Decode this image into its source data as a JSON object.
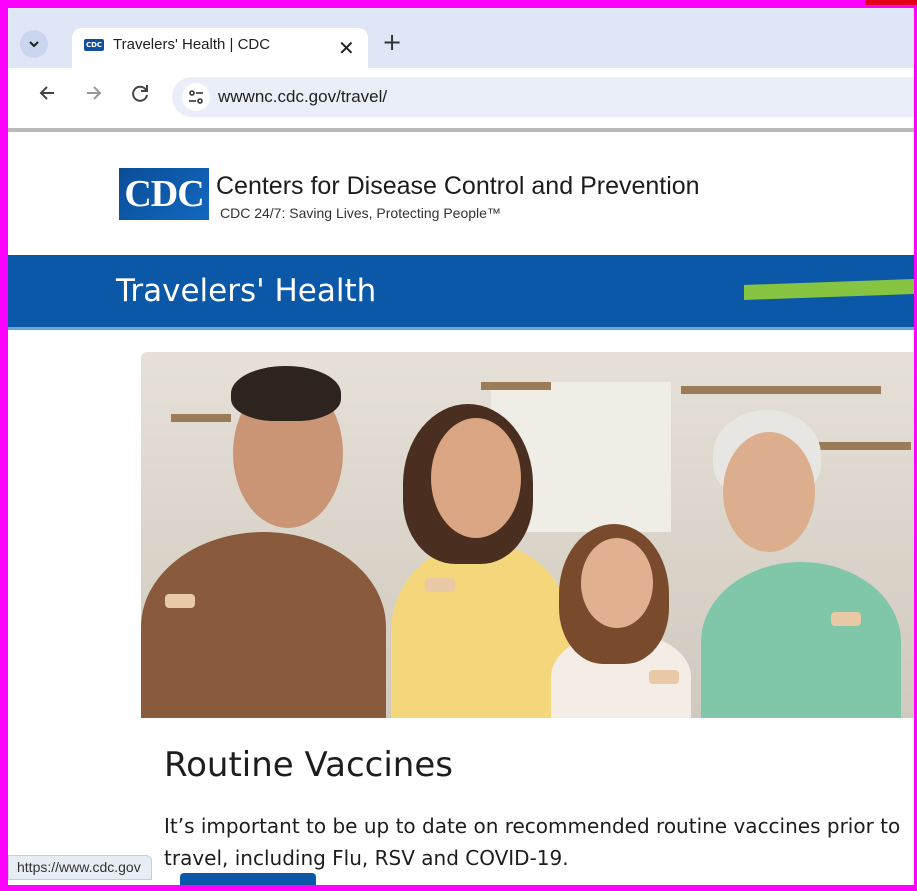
{
  "browser": {
    "tab_title": "Travelers' Health | CDC",
    "tab_close": "✕",
    "new_tab": "+",
    "url": "wwwnc.cdc.gov/travel/",
    "favicon_text": "CDC",
    "status_url": "https://www.cdc.gov"
  },
  "icons": {
    "tab_menu": "chevron-down-icon",
    "back": "arrow-left-icon",
    "forward": "arrow-right-icon",
    "reload": "reload-icon",
    "site_info": "tune-icon"
  },
  "header": {
    "logo_text": "CDC",
    "org_name": "Centers for Disease Control and Prevention",
    "tagline": "CDC 24/7: Saving Lives, Protecting People™"
  },
  "banner": {
    "title": "Travelers' Health"
  },
  "feature": {
    "heading": "Routine Vaccines",
    "body": "It’s important to be up to date on recommended routine vaccines prior to travel, including Flu, RSV and COVID-19."
  },
  "colors": {
    "frame": "#ff00ff",
    "banner_blue": "#0a58a7",
    "accent_green": "#86c441"
  }
}
